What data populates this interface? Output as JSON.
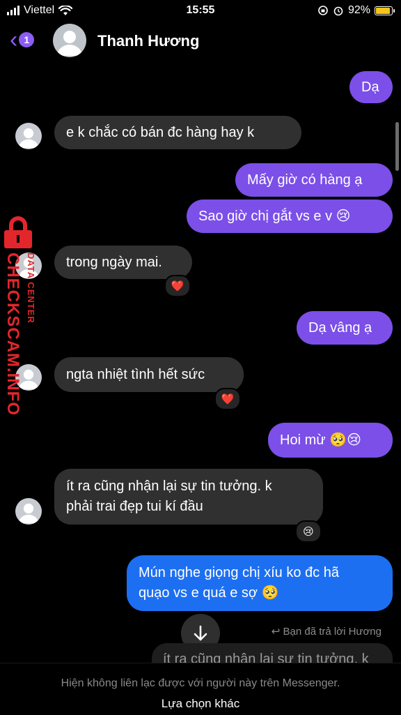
{
  "status_bar": {
    "carrier": "Viettel",
    "time": "15:55",
    "battery": "92%",
    "battery_level": 0.92
  },
  "header": {
    "back_count": "1",
    "contact_name": "Thanh Hương"
  },
  "messages": [
    {
      "side": "out",
      "text": "Dạ"
    },
    {
      "side": "in",
      "text": "e k chắc có bán đc hàng hay k"
    },
    {
      "side": "out",
      "text": "Mấy giờ có hàng ạ"
    },
    {
      "side": "out",
      "text": "Sao giờ chị gắt vs e v 😢"
    },
    {
      "side": "in",
      "text": "trong ngày mai.",
      "reaction": "❤️"
    },
    {
      "side": "out",
      "text": "Dạ vâng ạ"
    },
    {
      "side": "in",
      "text": "ngta nhiệt tình hết sức",
      "reaction": "❤️"
    },
    {
      "side": "out",
      "text": "Hoi mừ 🥺😢"
    },
    {
      "side": "in",
      "line1": "ít ra cũng nhận lại sự tin tưởng. k",
      "line2": "phải trai đẹp tui kí đầu",
      "reaction": "😢"
    },
    {
      "side": "out",
      "line1": "Mún nghe giọng chị xíu ko đc hã",
      "line2": "quạo vs e quá e sợ 🥺"
    }
  ],
  "reply_info": "Bạn đã trả lời Hương",
  "quoted_text": "ít ra cũng nhận lại sự tin tưởng. k",
  "watermark": {
    "line1": "DATA CENTER",
    "line2": "CHECKSCAM.INFO"
  },
  "footer": {
    "message": "Hiện không liên lạc được với người này trên Messenger.",
    "option": "Lựa chọn khác"
  },
  "colors": {
    "accent": "#8b5cf6",
    "outgoing": "#7b4fe8",
    "outgoing_blue": "#1d6ff2",
    "incoming": "#303030",
    "watermark": "#e3262b"
  }
}
